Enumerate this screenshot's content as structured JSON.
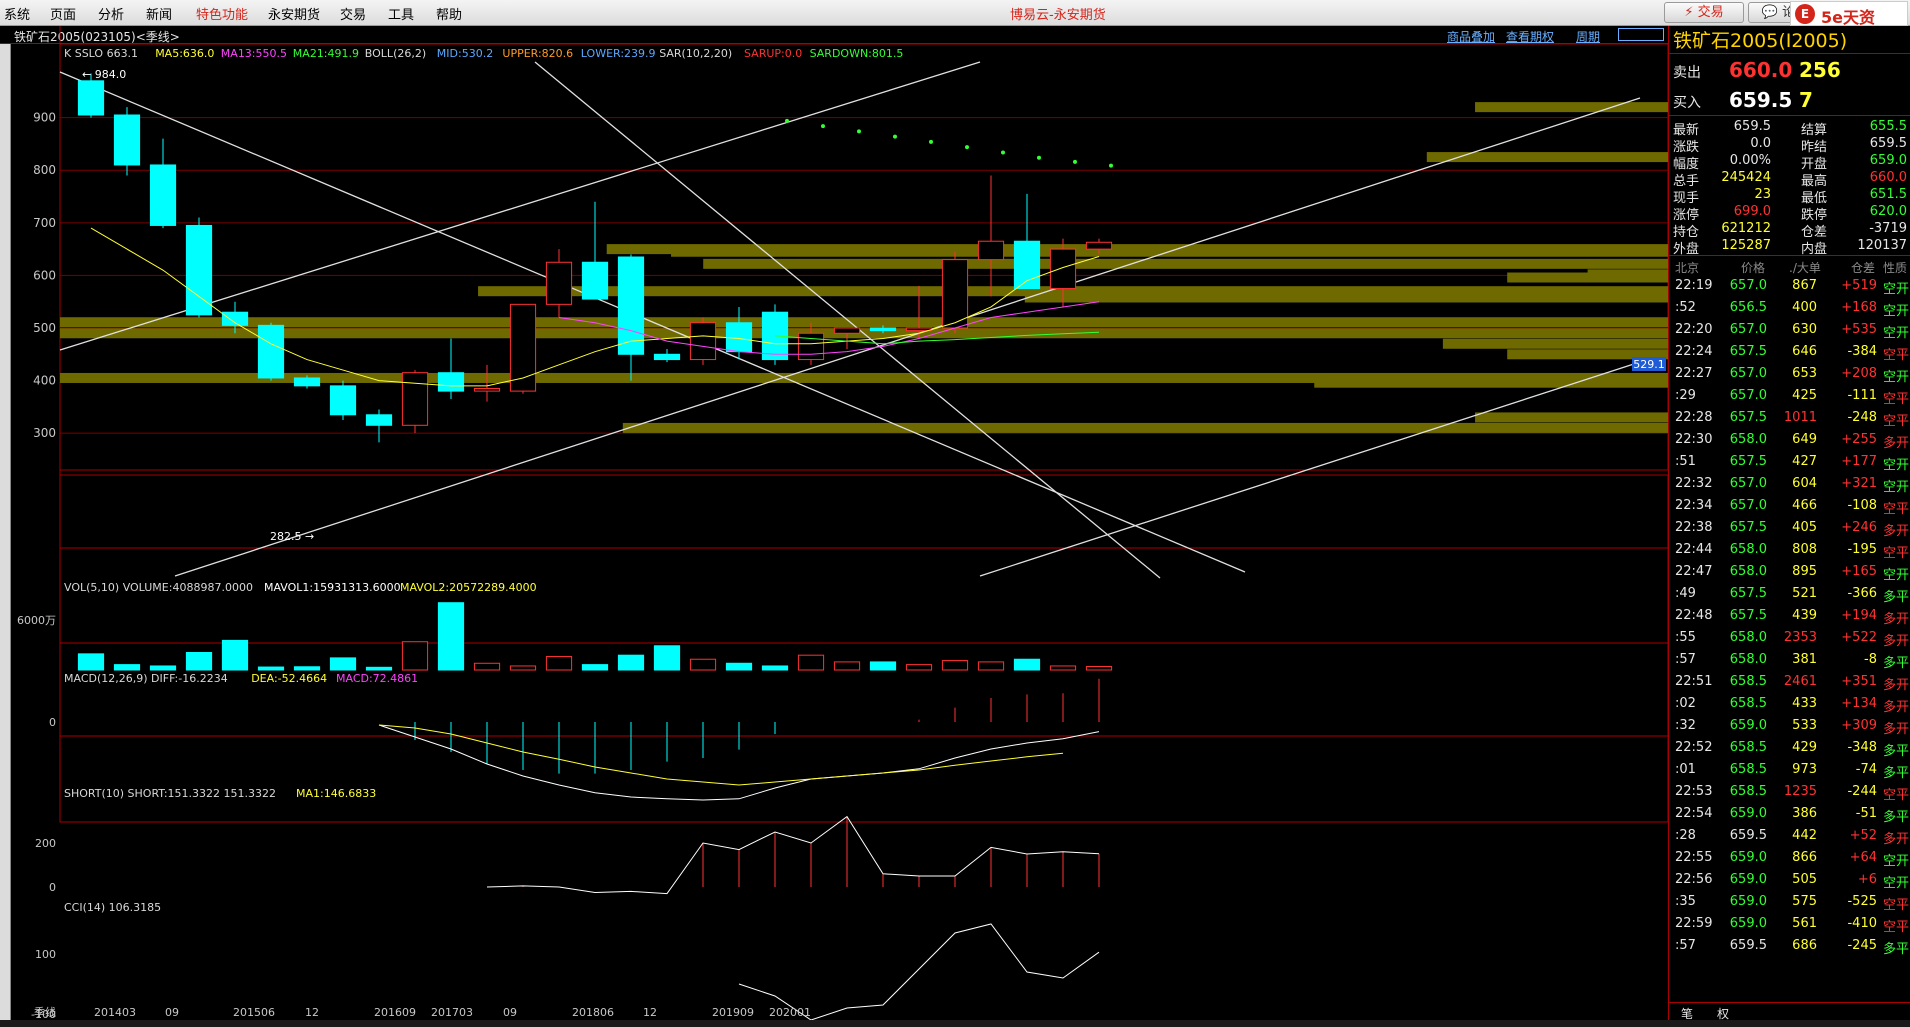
{
  "menu": [
    "系统",
    "页面",
    "分析",
    "新闻",
    "特色功能",
    "永安期货",
    "交易",
    "工具",
    "帮助"
  ],
  "app_title": "博易云-永安期货",
  "toolbar": {
    "trade": "交易",
    "forum": "论坛",
    "brand": "5e天资"
  },
  "subbar": {
    "instrument": "铁矿石2005(023105)<季线>",
    "links": [
      "商品叠加",
      "查看期权",
      "周期"
    ]
  },
  "indicators": {
    "main": [
      {
        "t": "K  SSLO 663.1",
        "c": "#d8d8d8"
      },
      {
        "t": "MA5:636.0",
        "c": "#ffff33"
      },
      {
        "t": "MA13:550.5",
        "c": "#ff44ff"
      },
      {
        "t": "MA21:491.9",
        "c": "#33ff33"
      },
      {
        "t": "BOLL(26,2)",
        "c": "#d8d8d8"
      },
      {
        "t": "MID:530.2",
        "c": "#5aa8ff"
      },
      {
        "t": "UPPER:820.6",
        "c": "#ff9922"
      },
      {
        "t": "LOWER:239.9",
        "c": "#5aa8ff"
      },
      {
        "t": "SAR(10,2,20)",
        "c": "#d8d8d8"
      },
      {
        "t": "SARUP:0.0",
        "c": "#ff3333"
      },
      {
        "t": "SARDOWN:801.5",
        "c": "#33ff33"
      }
    ],
    "vol": [
      {
        "t": "VOL(5,10)  VOLUME:4088987.0000",
        "c": "#d8d8d8"
      },
      {
        "t": "MAVOL1:15931313.6000",
        "c": "#ffffff"
      },
      {
        "t": "MAVOL2:20572289.4000",
        "c": "#ffff33"
      }
    ],
    "macd": [
      {
        "t": "MACD(12,26,9)  DIFF:-16.2234",
        "c": "#d8d8d8"
      },
      {
        "t": "DEA:-52.4664",
        "c": "#ffff33"
      },
      {
        "t": "MACD:72.4861",
        "c": "#ff44ff"
      }
    ],
    "short": [
      {
        "t": "SHORT(10)  SHORT:151.3322  151.3322",
        "c": "#d8d8d8"
      },
      {
        "t": "MA1:146.6833",
        "c": "#ffff33"
      }
    ],
    "cci": [
      {
        "t": "CCI(14)  106.3185",
        "c": "#d8d8d8"
      }
    ]
  },
  "axis": {
    "price_ticks": [
      "900",
      "800",
      "700",
      "600",
      "500",
      "400",
      "300"
    ],
    "vol_ticks": [
      "6000万"
    ],
    "macd_ticks": [
      "0"
    ],
    "short_ticks": [
      "200",
      "0"
    ],
    "cci_ticks": [
      "100",
      "-100"
    ],
    "x_labels": [
      "201403",
      "09",
      "201506",
      "12",
      "201609",
      "201703",
      "09",
      "201806",
      "12",
      "201909",
      "202001"
    ],
    "period_label": "季线",
    "max_label": "984.0",
    "min_label": "282.5",
    "cursor_price": "529.1"
  },
  "chart_data": {
    "type": "candlestick",
    "period": "季线",
    "candles": [
      {
        "o": 970,
        "h": 984,
        "l": 900,
        "c": 905
      },
      {
        "o": 905,
        "h": 920,
        "l": 790,
        "c": 810
      },
      {
        "o": 810,
        "h": 860,
        "l": 690,
        "c": 695
      },
      {
        "o": 695,
        "h": 710,
        "l": 520,
        "c": 525
      },
      {
        "o": 530,
        "h": 550,
        "l": 490,
        "c": 505
      },
      {
        "o": 505,
        "h": 510,
        "l": 400,
        "c": 405
      },
      {
        "o": 405,
        "h": 410,
        "l": 385,
        "c": 390
      },
      {
        "o": 390,
        "h": 400,
        "l": 325,
        "c": 335
      },
      {
        "o": 335,
        "h": 345,
        "l": 282.5,
        "c": 315
      },
      {
        "o": 315,
        "h": 420,
        "l": 300,
        "c": 415
      },
      {
        "o": 415,
        "h": 480,
        "l": 365,
        "c": 380
      },
      {
        "o": 380,
        "h": 430,
        "l": 360,
        "c": 385
      },
      {
        "o": 380,
        "h": 520,
        "l": 375,
        "c": 545
      },
      {
        "o": 545,
        "h": 650,
        "l": 520,
        "c": 625
      },
      {
        "o": 625,
        "h": 740,
        "l": 580,
        "c": 555
      },
      {
        "o": 635,
        "h": 640,
        "l": 400,
        "c": 450
      },
      {
        "o": 450,
        "h": 460,
        "l": 435,
        "c": 440
      },
      {
        "o": 440,
        "h": 520,
        "l": 430,
        "c": 510
      },
      {
        "o": 510,
        "h": 540,
        "l": 440,
        "c": 455
      },
      {
        "o": 530,
        "h": 545,
        "l": 430,
        "c": 440
      },
      {
        "o": 440,
        "h": 510,
        "l": 430,
        "c": 490
      },
      {
        "o": 490,
        "h": 500,
        "l": 460,
        "c": 500
      },
      {
        "o": 500,
        "h": 505,
        "l": 490,
        "c": 495
      },
      {
        "o": 495,
        "h": 580,
        "l": 480,
        "c": 500
      },
      {
        "o": 500,
        "h": 645,
        "l": 490,
        "c": 630
      },
      {
        "o": 630,
        "h": 790,
        "l": 560,
        "c": 665
      },
      {
        "o": 665,
        "h": 755,
        "l": 600,
        "c": 575
      },
      {
        "o": 575,
        "h": 670,
        "l": 540,
        "c": 650
      },
      {
        "o": 650,
        "h": 670,
        "l": 640,
        "c": 663
      }
    ],
    "volume": [
      6000000.0,
      2000000.0,
      1500000.0,
      6500000.0,
      11000000.0,
      1100000.0,
      1200000.0,
      4500000.0,
      1000000.0,
      10500000.0,
      25000000.0,
      2500000.0,
      1500000.0,
      5000000.0,
      2000000.0,
      5500000.0,
      9000000.0,
      4000000.0,
      2500000.0,
      1500000.0,
      5500000.0,
      3000000.0,
      3000000.0,
      2000000.0,
      3500000.0,
      3000000.0,
      4000000.0,
      1500000.0,
      1300000.0
    ],
    "sar": [
      890,
      880,
      870,
      860,
      850,
      840,
      830,
      820,
      812,
      805
    ],
    "sma5": [
      690,
      650,
      610,
      560,
      510,
      470,
      440,
      420,
      400,
      395,
      390,
      390,
      405,
      430,
      455,
      475,
      480,
      485,
      480,
      470,
      470,
      475,
      480,
      490,
      510,
      540,
      590,
      615,
      636
    ],
    "ma13": [
      520,
      510,
      495,
      475,
      465,
      455,
      450,
      450,
      455,
      465,
      480,
      500,
      520,
      530,
      540,
      550
    ],
    "ma21": [
      485,
      480,
      475,
      470,
      475,
      478,
      482,
      486,
      489,
      492
    ],
    "macd_diff": [
      -5,
      -25,
      -45,
      -70,
      -90,
      -105,
      -118,
      -125,
      -128,
      -130,
      -128,
      -110,
      -95,
      -90,
      -85,
      -78,
      -60,
      -45,
      -35,
      -28,
      -16
    ],
    "macd_dea": [
      -5,
      -10,
      -20,
      -35,
      -50,
      -62,
      -75,
      -85,
      -95,
      -100,
      -105,
      -100,
      -95,
      -90,
      -85,
      -80,
      -72,
      -65,
      -58,
      -52
    ],
    "cci": [
      0,
      -40,
      -120,
      -80,
      -70,
      50,
      170,
      200,
      40,
      20,
      106
    ],
    "short": [
      0,
      5,
      0,
      -25,
      -20,
      -30,
      200,
      170,
      250,
      200,
      320,
      60,
      50,
      50,
      180,
      150,
      160,
      151
    ],
    "ylabel": "",
    "ylim": [
      230,
      1040
    ]
  },
  "depth_bars": [
    {
      "price": 920,
      "len": 0.12
    },
    {
      "price": 825,
      "len": 0.15
    },
    {
      "price": 650,
      "len": 0.66
    },
    {
      "price": 645,
      "len": 0.62
    },
    {
      "price": 622,
      "len": 0.6
    },
    {
      "price": 570,
      "len": 0.74
    },
    {
      "price": 602,
      "len": 0.05
    },
    {
      "price": 596,
      "len": 0.1
    },
    {
      "price": 558,
      "len": 0.4
    },
    {
      "price": 511,
      "len": 1.0
    },
    {
      "price": 490,
      "len": 1.0
    },
    {
      "price": 470,
      "len": 0.14
    },
    {
      "price": 450,
      "len": 0.1
    },
    {
      "price": 405,
      "len": 1.0
    },
    {
      "price": 396,
      "len": 0.22
    },
    {
      "price": 330,
      "len": 0.12
    },
    {
      "price": 310,
      "len": 0.65
    }
  ],
  "quote": {
    "title": "铁矿石2005(I2005)",
    "sell_label": "卖出",
    "sell_price": "660.0",
    "sell_vol": "256",
    "buy_label": "买入",
    "buy_price": "659.5",
    "buy_vol": "7",
    "stats": [
      [
        "最新",
        "659.5",
        "结算",
        "655.5"
      ],
      [
        "涨跌",
        "0.0",
        "昨结",
        "659.5"
      ],
      [
        "幅度",
        "0.00%",
        "开盘",
        "659.0"
      ],
      [
        "总手",
        "245424",
        "最高",
        "660.0"
      ],
      [
        "现手",
        "23",
        "最低",
        "651.5"
      ],
      [
        "涨停",
        "699.0",
        "跌停",
        "620.0"
      ],
      [
        "持仓",
        "621212",
        "仓差",
        "-3719"
      ],
      [
        "外盘",
        "125287",
        "内盘",
        "120137"
      ]
    ],
    "tick_header": [
      "北京",
      "价格",
      "./大单",
      "仓差",
      "性质"
    ],
    "ticks": [
      [
        "22:19",
        "657.0",
        "867",
        "+519",
        "空开"
      ],
      [
        ":52",
        "656.5",
        "400",
        "+168",
        "空开"
      ],
      [
        "22:20",
        "657.0",
        "630",
        "+535",
        "空开"
      ],
      [
        "22:24",
        "657.5",
        "646",
        "-384",
        "空平"
      ],
      [
        "22:27",
        "657.0",
        "653",
        "+208",
        "空开"
      ],
      [
        ":29",
        "657.0",
        "425",
        "-111",
        "空平"
      ],
      [
        "22:28",
        "657.5",
        "1011",
        "-248",
        "空平"
      ],
      [
        "22:30",
        "658.0",
        "649",
        "+255",
        "多开"
      ],
      [
        ":51",
        "657.5",
        "427",
        "+177",
        "空开"
      ],
      [
        "22:32",
        "657.0",
        "604",
        "+321",
        "空开"
      ],
      [
        "22:34",
        "657.0",
        "466",
        "-108",
        "空平"
      ],
      [
        "22:38",
        "657.5",
        "405",
        "+246",
        "多开"
      ],
      [
        "22:44",
        "658.0",
        "808",
        "-195",
        "空平"
      ],
      [
        "22:47",
        "658.0",
        "895",
        "+165",
        "空开"
      ],
      [
        ":49",
        "657.5",
        "521",
        "-366",
        "多平"
      ],
      [
        "22:48",
        "657.5",
        "439",
        "+194",
        "多开"
      ],
      [
        ":55",
        "658.0",
        "2353",
        "+522",
        "多开"
      ],
      [
        ":57",
        "658.0",
        "381",
        "-8",
        "多平"
      ],
      [
        "22:51",
        "658.5",
        "2461",
        "+351",
        "多开"
      ],
      [
        ":02",
        "658.5",
        "433",
        "+134",
        "多开"
      ],
      [
        ":32",
        "659.0",
        "533",
        "+309",
        "多开"
      ],
      [
        "22:52",
        "658.5",
        "429",
        "-348",
        "多平"
      ],
      [
        ":01",
        "658.5",
        "973",
        "-74",
        "多平"
      ],
      [
        "22:53",
        "658.5",
        "1235",
        "-244",
        "空平"
      ],
      [
        "22:54",
        "659.0",
        "386",
        "-51",
        "多平"
      ],
      [
        ":28",
        "659.5",
        "442",
        "+52",
        "多开"
      ],
      [
        "22:55",
        "659.0",
        "866",
        "+64",
        "空开"
      ],
      [
        "22:56",
        "659.0",
        "505",
        "+6",
        "空开"
      ],
      [
        ":35",
        "659.0",
        "575",
        "-525",
        "空平"
      ],
      [
        "22:59",
        "659.0",
        "561",
        "-410",
        "空平"
      ],
      [
        ":57",
        "659.5",
        "686",
        "-245",
        "多平"
      ]
    ],
    "bottom_tabs": [
      "笔",
      "权"
    ]
  },
  "colors": {
    "up": "#ff3232",
    "down": "#00ffff",
    "grid": "#7a0000",
    "text": "#c8c8c8",
    "depth": "#6e6a00"
  }
}
